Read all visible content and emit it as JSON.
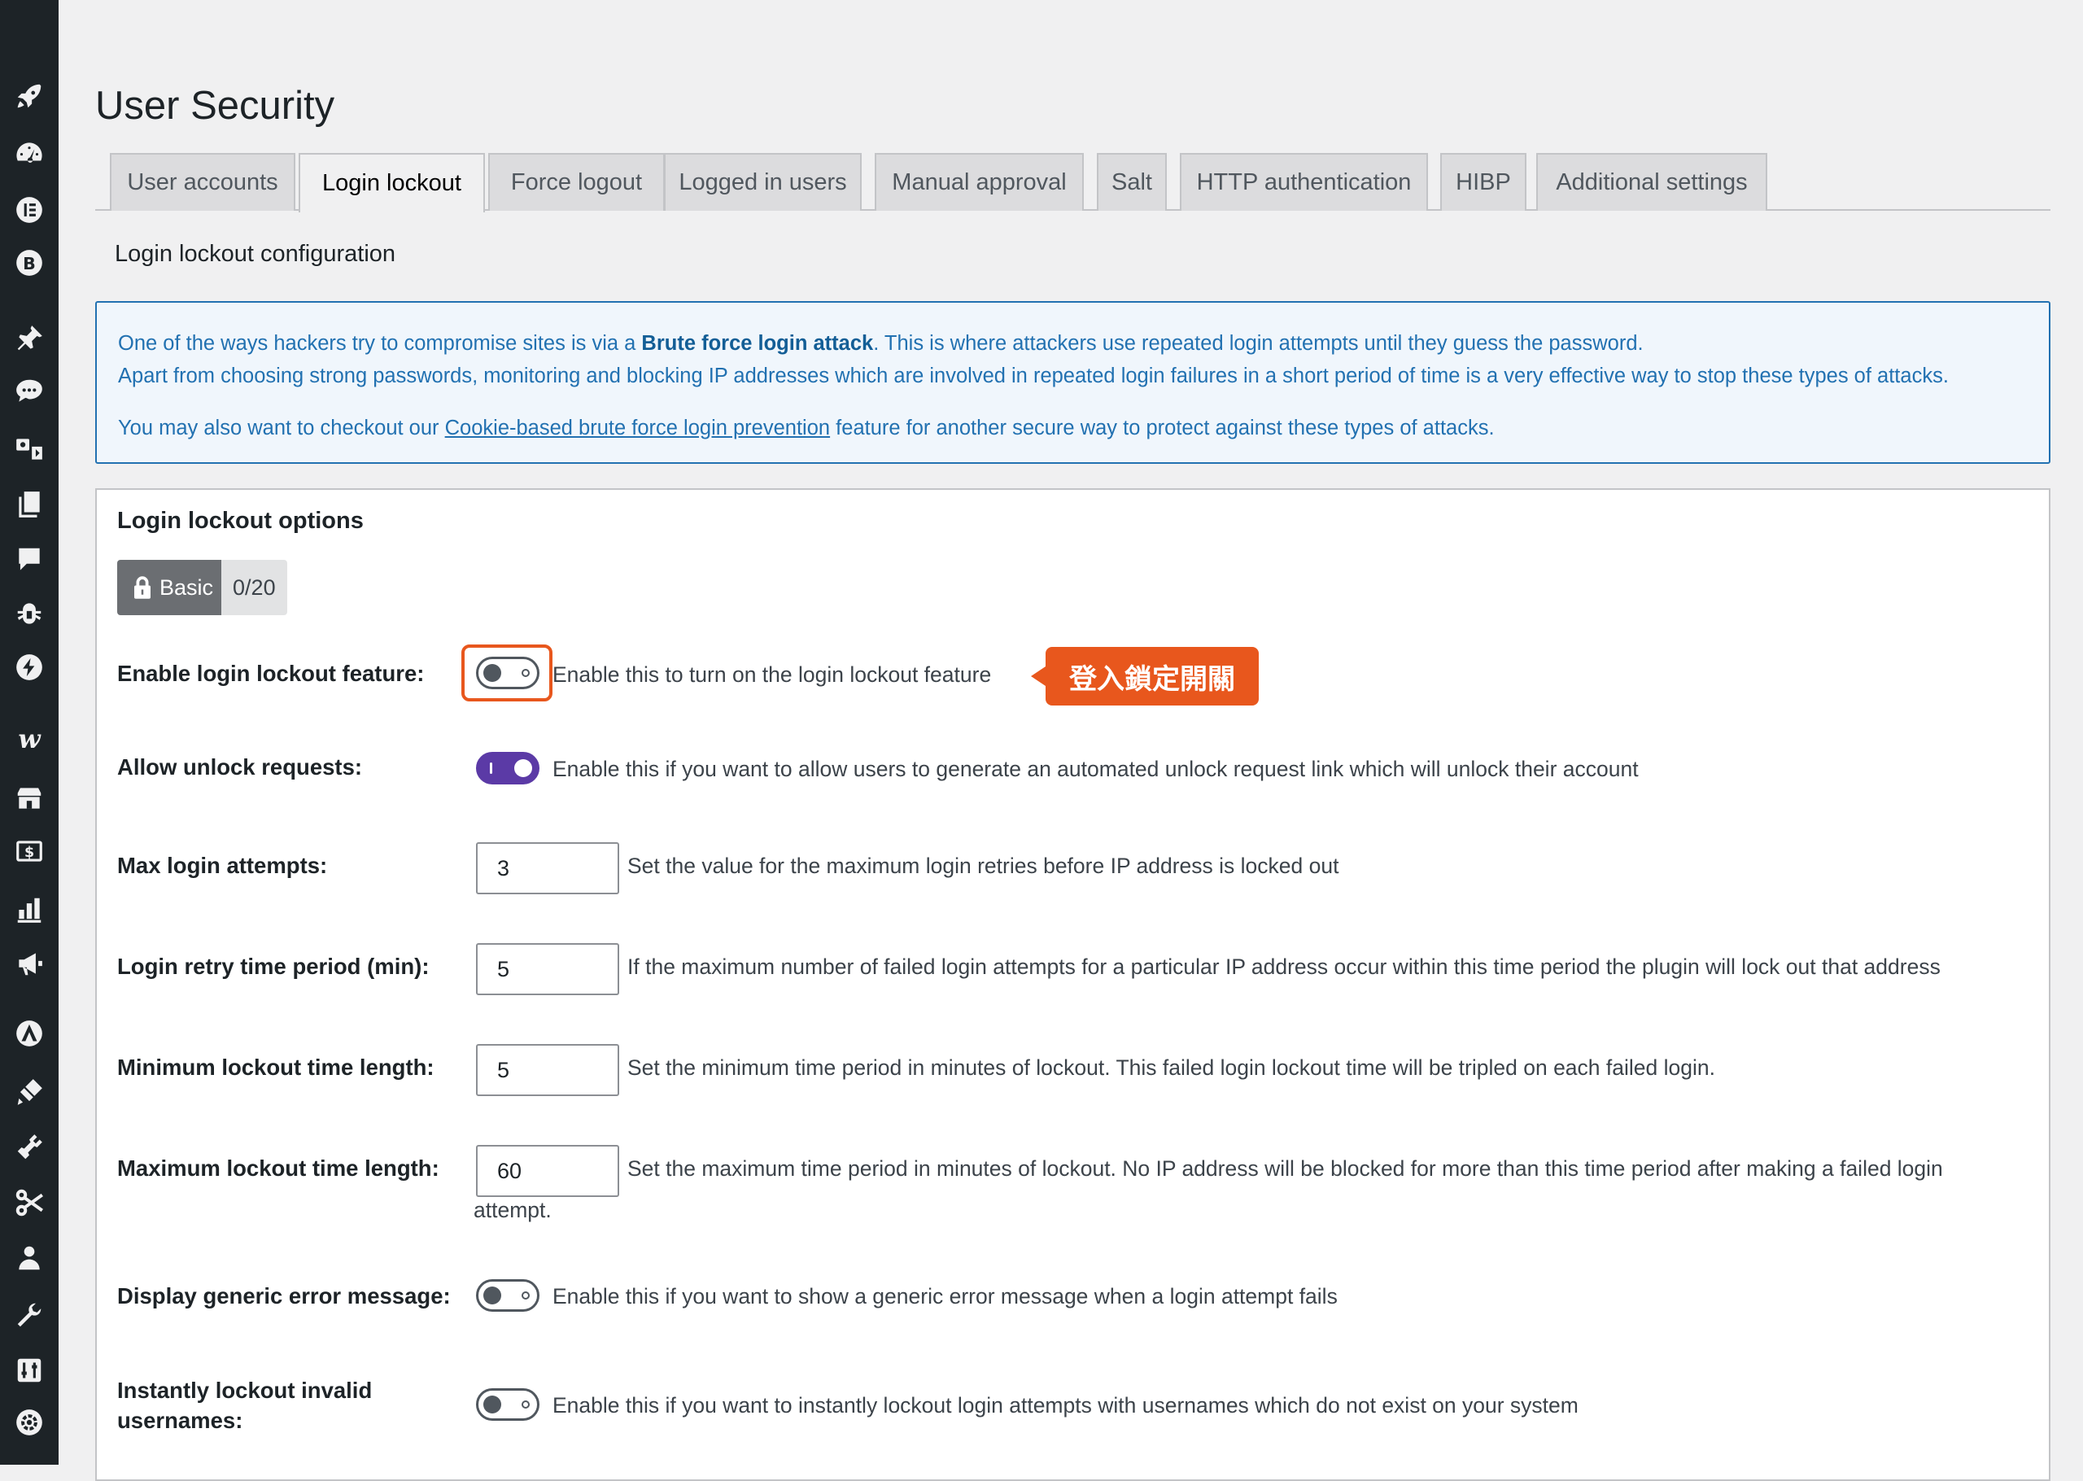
{
  "page": {
    "title": "User Security"
  },
  "tabs": [
    {
      "label": "User accounts",
      "active": false
    },
    {
      "label": "Login lockout",
      "active": true
    },
    {
      "label": "Force logout",
      "active": false
    },
    {
      "label": "Logged in users",
      "active": false
    },
    {
      "label": "Manual approval",
      "active": false
    },
    {
      "label": "Salt",
      "active": false
    },
    {
      "label": "HTTP authentication",
      "active": false
    },
    {
      "label": "HIBP",
      "active": false
    },
    {
      "label": "Additional settings",
      "active": false
    }
  ],
  "section": {
    "heading": "Login lockout configuration"
  },
  "notice": {
    "line1_pre": "One of the ways hackers try to compromise sites is via a ",
    "line1_strong": "Brute force login attack",
    "line1_post": ". This is where attackers use repeated login attempts until they guess the password.",
    "line2": "Apart from choosing strong passwords, monitoring and blocking IP addresses which are involved in repeated login failures in a short period of time is a very effective way to stop these types of attacks.",
    "line3_pre": "You may also want to checkout our ",
    "line3_link": "Cookie-based brute force login prevention",
    "line3_post": " feature for another secure way to protect against these types of attacks."
  },
  "panel": {
    "title": "Login lockout options",
    "badge_level": "Basic",
    "badge_score": "0/20"
  },
  "options": {
    "enable_lockout": {
      "label": "Enable login lockout feature:",
      "desc": "Enable this to turn on the login lockout feature",
      "on": false,
      "callout": "登入鎖定開關"
    },
    "allow_unlock": {
      "label": "Allow unlock requests:",
      "desc": "Enable this if you want to allow users to generate an automated unlock request link which will unlock their account",
      "on": true
    },
    "max_attempts": {
      "label": "Max login attempts:",
      "value": "3",
      "desc": "Set the value for the maximum login retries before IP address is locked out"
    },
    "retry_period": {
      "label": "Login retry time period (min):",
      "value": "5",
      "desc": "If the maximum number of failed login attempts for a particular IP address occur within this time period the plugin will lock out that address"
    },
    "min_lockout": {
      "label": "Minimum lockout time length:",
      "value": "5",
      "desc": "Set the minimum time period in minutes of lockout. This failed login lockout time will be tripled on each failed login."
    },
    "max_lockout": {
      "label": "Maximum lockout time length:",
      "value": "60",
      "desc": "Set the maximum time period in minutes of lockout. No IP address will be blocked for more than this time period after making a failed login",
      "desc_cont": "attempt."
    },
    "generic_error": {
      "label": "Display generic error message:",
      "desc": "Enable this if you want to show a generic error message when a login attempt fails",
      "on": false
    },
    "instant_lockout": {
      "label_line1": "Instantly lockout invalid",
      "label_line2": "usernames:",
      "desc": "Enable this if you want to instantly lockout login attempts with usernames which do not exist on your system",
      "on": false
    }
  },
  "sidebar_icons": [
    "rocket-icon",
    "dashboard-icon",
    "elementor-icon",
    "bold-b-icon",
    "pin-icon",
    "comments-icon",
    "media-icon",
    "pages-icon",
    "comment-icon",
    "bug-icon",
    "bolt-circle-icon",
    "woo-icon",
    "store-icon",
    "dollar-icon",
    "chart-icon",
    "megaphone-icon",
    "astra-icon",
    "appearance-icon",
    "plugins-icon",
    "scissors-icon",
    "users-icon",
    "tools-icon",
    "sliders-icon",
    "settings-icon"
  ],
  "colors": {
    "accent": "#2271b1",
    "toggle_on": "#5b3aa6",
    "callout": "#e8571d"
  }
}
